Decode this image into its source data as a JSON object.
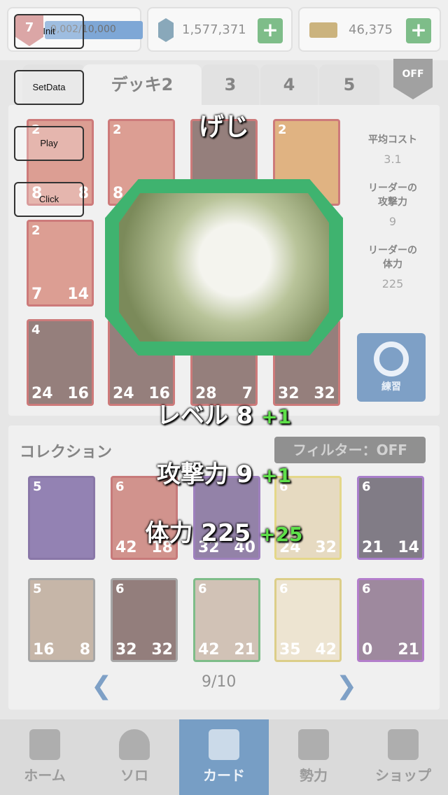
{
  "topbar": {
    "level": "7",
    "xp_text": "0,002/10,000",
    "gems": "1,577,371",
    "gold": "46,375"
  },
  "tabs": [
    {
      "label": "デッキ2"
    },
    {
      "label": "3"
    },
    {
      "label": "4"
    },
    {
      "label": "5"
    }
  ],
  "off_badge": "OFF",
  "deck_stats": {
    "avg_cost_label": "平均コスト",
    "avg_cost_value": "3.1",
    "leader_atk_label": "リーダーの\n攻撃力",
    "leader_atk_value": "9",
    "leader_hp_label": "リーダーの\n体力",
    "leader_hp_value": "225",
    "practice_label": "練習"
  },
  "deck_cards": [
    {
      "cost": "2",
      "atk": "8",
      "hp": "8"
    },
    {
      "cost": "2",
      "atk": "8",
      "hp": ""
    },
    {
      "cost": "",
      "atk": "",
      "hp": ""
    },
    {
      "cost": "2",
      "atk": "",
      "hp": ""
    },
    {
      "cost": "2",
      "atk": "7",
      "hp": "14"
    },
    {
      "cost": "4",
      "atk": "24",
      "hp": "16"
    },
    {
      "cost": "",
      "atk": "24",
      "hp": "16"
    },
    {
      "cost": "",
      "atk": "28",
      "hp": "7"
    },
    {
      "cost": "",
      "atk": "32",
      "hp": "32"
    }
  ],
  "collection": {
    "title": "コレクション",
    "filter": "フィルター：OFF",
    "page": "9/10",
    "cards": [
      {
        "cost": "5",
        "atk": "",
        "hp": ""
      },
      {
        "cost": "6",
        "atk": "42",
        "hp": "18"
      },
      {
        "cost": "",
        "atk": "32",
        "hp": "40"
      },
      {
        "cost": "6",
        "atk": "24",
        "hp": "32"
      },
      {
        "cost": "6",
        "atk": "21",
        "hp": "14"
      },
      {
        "cost": "5",
        "atk": "16",
        "hp": "8"
      },
      {
        "cost": "6",
        "atk": "32",
        "hp": "32"
      },
      {
        "cost": "6",
        "atk": "42",
        "hp": "21"
      },
      {
        "cost": "6",
        "atk": "35",
        "hp": "42"
      },
      {
        "cost": "6",
        "atk": "0",
        "hp": "21"
      }
    ]
  },
  "nav": [
    {
      "label": "ホーム"
    },
    {
      "label": "ソロ"
    },
    {
      "label": "カード"
    },
    {
      "label": "勢力"
    },
    {
      "label": "ショップ"
    }
  ],
  "debug_buttons": [
    {
      "label": "Init"
    },
    {
      "label": "SetData"
    },
    {
      "label": "Play"
    },
    {
      "label": "Click"
    }
  ],
  "popup": {
    "name": "げじ",
    "level_label": "レベル 8",
    "level_bonus": "+1",
    "atk_label": "攻撃力 9",
    "atk_bonus": "+1",
    "hp_label": "体力 225",
    "hp_bonus": "+25"
  },
  "colors": {
    "frame_green": "#3fb36f",
    "bonus_green": "#5fe04a",
    "nav_active": "#2f6aa6",
    "card_red": "#b23333"
  }
}
